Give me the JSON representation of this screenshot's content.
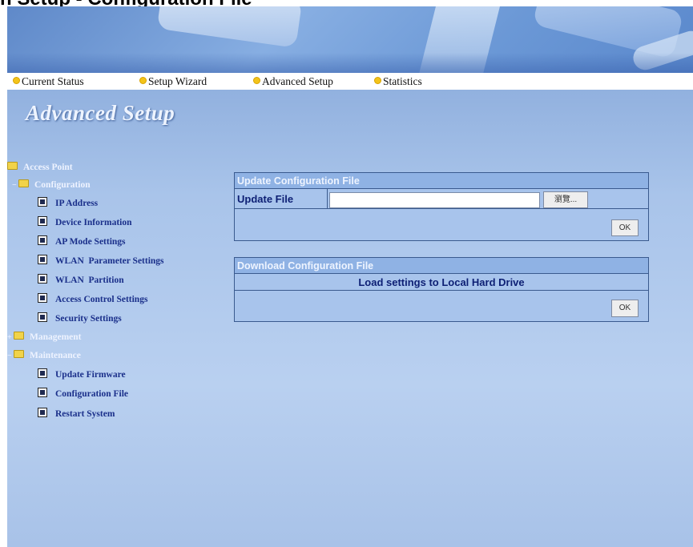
{
  "page_heading": "n Setup - Configuration File",
  "nav": [
    {
      "label": "Current Status"
    },
    {
      "label": "Setup Wizard"
    },
    {
      "label": "Advanced Setup"
    },
    {
      "label": "Statistics"
    }
  ],
  "section_title": "Advanced Setup",
  "tree": {
    "root": "Access Point",
    "configuration": {
      "label": "Configuration",
      "items": [
        "IP Address",
        "Device Information",
        "AP Mode Settings",
        "WLAN  Parameter Settings",
        "WLAN  Partition",
        "Access Control Settings",
        "Security Settings"
      ]
    },
    "management": {
      "label": "Management"
    },
    "maintenance": {
      "label": "Maintenance",
      "items": [
        "Update Firmware",
        "Configuration File",
        "Restart System"
      ]
    }
  },
  "update_panel": {
    "title": "Update Configuration File",
    "field_label": "Update File",
    "file_value": "",
    "browse_label": "瀏覽...",
    "ok_label": "OK"
  },
  "download_panel": {
    "title": "Download Configuration File",
    "text": "Load settings to Local Hard Drive",
    "ok_label": "OK"
  }
}
